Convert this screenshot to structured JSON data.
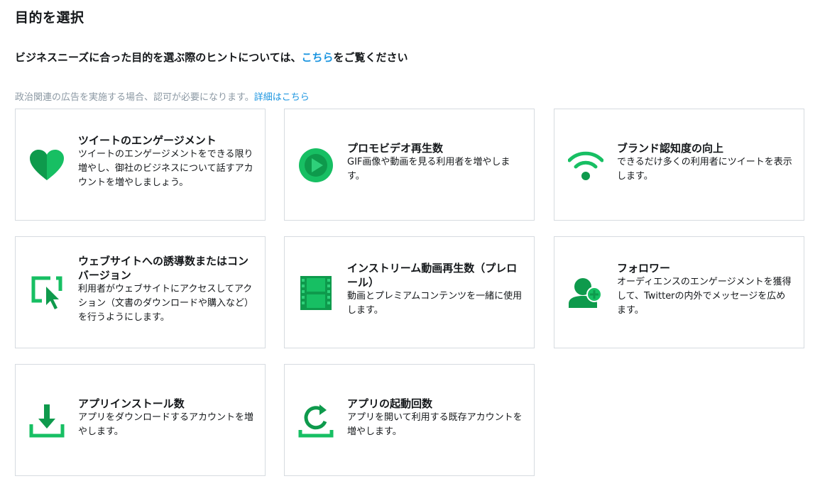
{
  "header": {
    "title": "目的を選択",
    "hint_prefix": "ビジネスニーズに合った目的を選ぶ際のヒントについては、",
    "hint_link": "こちら",
    "hint_suffix": "をご覧ください",
    "notice_text": "政治関連の広告を実施する場合、認可が必要になります。",
    "notice_link": "詳細はこちら"
  },
  "colors": {
    "accent_green": "#17bf63",
    "dark_green": "#0e9a4c",
    "link_blue": "#1b95e0"
  },
  "objectives": [
    {
      "title": "ツイートのエンゲージメント",
      "description": "ツイートのエンゲージメントをできる限り増やし、御社のビジネスについて話すアカウントを増やしましょう。",
      "icon": "heart-icon"
    },
    {
      "title": "プロモビデオ再生数",
      "description": "GIF画像や動画を見る利用者を増やします。",
      "icon": "play-icon"
    },
    {
      "title": "ブランド認知度の向上",
      "description": "できるだけ多くの利用者にツイートを表示します。",
      "icon": "wifi-icon"
    },
    {
      "title": "ウェブサイトへの誘導数またはコンバージョン",
      "description": "利用者がウェブサイトにアクセスしてアクション（文書のダウンロードや購入など）を行うようにします。",
      "icon": "cursor-click-icon"
    },
    {
      "title": "インストリーム動画再生数（プレロール）",
      "description": "動画とプレミアムコンテンツを一緒に使用します。",
      "icon": "film-icon"
    },
    {
      "title": "フォロワー",
      "description": "オーディエンスのエンゲージメントを獲得して、Twitterの内外でメッセージを広めます。",
      "icon": "add-follower-icon"
    },
    {
      "title": "アプリインストール数",
      "description": "アプリをダウンロードするアカウントを増やします。",
      "icon": "download-icon"
    },
    {
      "title": "アプリの起動回数",
      "description": "アプリを開いて利用する既存アカウントを増やします。",
      "icon": "reload-icon"
    }
  ]
}
